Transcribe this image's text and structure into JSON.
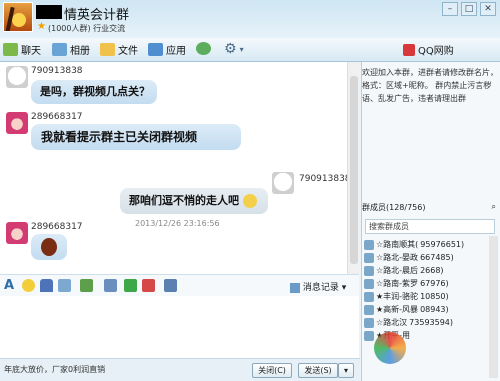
{
  "window": {
    "group_name": "情英会计群",
    "group_sub": "(1000人群) 行业交流"
  },
  "toolbar": {
    "items": [
      {
        "label": "聊天"
      },
      {
        "label": "相册"
      },
      {
        "label": "文件"
      },
      {
        "label": "应用"
      }
    ],
    "shop_label": "QQ网购"
  },
  "chat": {
    "messages": [
      {
        "sender": "790913838",
        "text": "是吗，群视频几点关？"
      },
      {
        "sender": "289668317",
        "text": "我就看提示群主已关闭群视频"
      },
      {
        "sender": "790913838",
        "text": "那咱们逗不悄的走人吧"
      },
      {
        "sender": "289668317",
        "text": ""
      }
    ],
    "timestamp": "2013/12/26 23:16:56"
  },
  "format_bar": {
    "history_label": "消息记录"
  },
  "bottom_bar": {
    "ad_text": "年底大放价，厂家0利润直销",
    "close_label": "关闭(C)",
    "send_label": "发送(S)"
  },
  "sidebar": {
    "notice": "欢迎加入本群，进群者请修改群名片，格式：区域+昵称。 群内禁止污言秽语、乱发广告，违者请理出群",
    "members_header": "群成员(128/756)",
    "search_placeholder": "搜索群成员",
    "members": [
      {
        "name": "☆路南顺其(",
        "id": "95976651)"
      },
      {
        "name": "☆路北-晏政",
        "id": "667485)"
      },
      {
        "name": "☆路北-晨后",
        "id": "2668)"
      },
      {
        "name": "☆路南-紫罗",
        "id": "67976)"
      },
      {
        "name": "★丰润-骆驼",
        "id": "10850)"
      },
      {
        "name": "★高新-风暴",
        "id": "08943)"
      },
      {
        "name": "☆路北汉",
        "id": "73593594)"
      },
      {
        "name": "★开平-用",
        "id": ""
      }
    ]
  },
  "colors": {
    "accent": "#2d6fa8",
    "bubble_left": "#c9e0f2",
    "shop_red": "#d9383a"
  }
}
